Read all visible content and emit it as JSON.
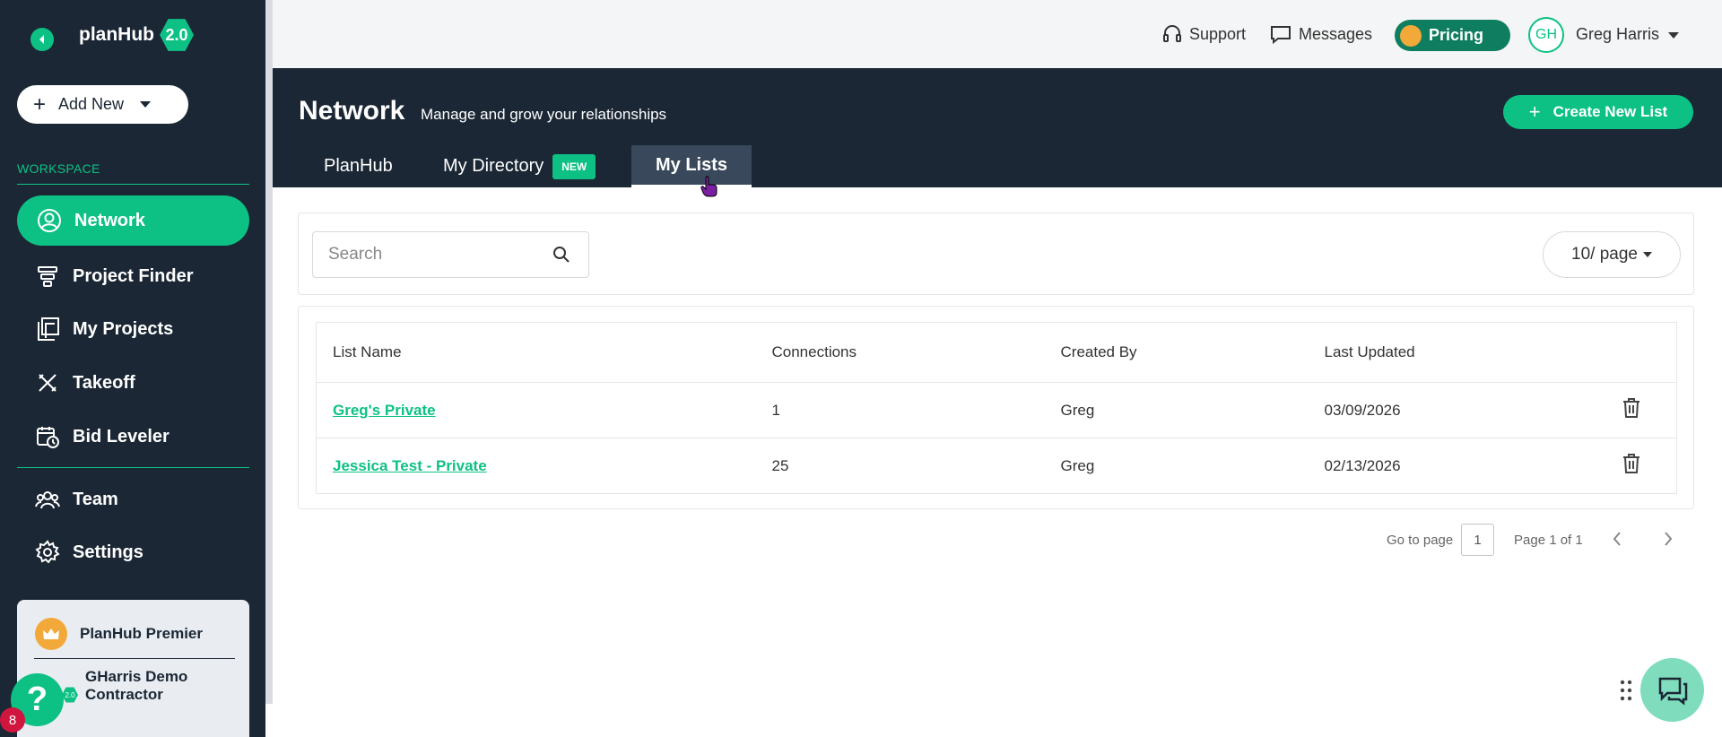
{
  "sidebar": {
    "logo_text": "planHub",
    "logo_version": "2.0",
    "add_new_label": "Add New",
    "workspace_label": "WORKSPACE",
    "items": [
      {
        "label": "Network",
        "icon": "user-circle-icon"
      },
      {
        "label": "Project Finder",
        "icon": "layers-icon"
      },
      {
        "label": "My Projects",
        "icon": "documents-icon"
      },
      {
        "label": "Takeoff",
        "icon": "ruler-pencil-icon"
      },
      {
        "label": "Bid Leveler",
        "icon": "calendar-clock-icon"
      },
      {
        "label": "Team",
        "icon": "team-icon"
      },
      {
        "label": "Settings",
        "icon": "gear-icon"
      }
    ],
    "plan_name": "PlanHub Premier",
    "company_name": "GHarris Demo Contractor",
    "company_badge": "2.0",
    "help_badge_count": "8"
  },
  "topbar": {
    "support_label": "Support",
    "messages_label": "Messages",
    "pricing_label": "Pricing",
    "user_initials": "GH",
    "user_name": "Greg Harris"
  },
  "header": {
    "title": "Network",
    "subtitle": "Manage and grow your relationships",
    "create_button": "Create New List",
    "tabs": [
      {
        "label": "PlanHub",
        "active": false
      },
      {
        "label": "My Directory",
        "active": false,
        "badge": "NEW"
      },
      {
        "label": "My Lists",
        "active": true
      }
    ]
  },
  "search": {
    "placeholder": "Search",
    "page_size": "10/ page"
  },
  "table": {
    "columns": [
      "List Name",
      "Connections",
      "Created By",
      "Last Updated"
    ],
    "rows": [
      {
        "name": "Greg's Private",
        "connections": "1",
        "created_by": "Greg",
        "updated": "03/09/2026"
      },
      {
        "name": "Jessica Test - Private",
        "connections": "25",
        "created_by": "Greg",
        "updated": "02/13/2026"
      }
    ]
  },
  "pagination": {
    "goto_label": "Go to page",
    "current_page": "1",
    "page_of": "Page 1 of 1"
  },
  "colors": {
    "brand_green": "#0dc184",
    "navy": "#1b2735",
    "pricing_bg": "#0f7d60"
  }
}
